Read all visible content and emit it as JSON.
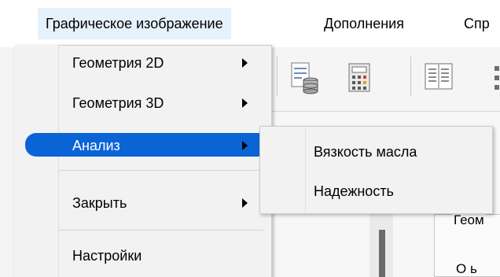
{
  "menubar": {
    "items": [
      {
        "label": "Графическое изображение"
      },
      {
        "label": "Дополнения"
      },
      {
        "label": "Спр"
      }
    ]
  },
  "menu": {
    "items": [
      {
        "label": "Геометрия 2D",
        "has_submenu": true
      },
      {
        "label": "Геометрия 3D",
        "has_submenu": true
      },
      {
        "label": "Анализ",
        "has_submenu": true,
        "highlighted": true
      },
      {
        "label": "Закрыть",
        "has_submenu": true
      },
      {
        "label": "Настройки",
        "has_submenu": false
      }
    ]
  },
  "submenu": {
    "items": [
      {
        "label": "Вязкость  масла"
      },
      {
        "label": "Надежность"
      }
    ]
  },
  "background": {
    "groupbox_caption": "Геом",
    "bottom_text": "О  ь"
  },
  "colors": {
    "highlight": "#0a64d6",
    "menubar_active": "#e5f1fb",
    "menu_bg": "#f2f2f2"
  }
}
